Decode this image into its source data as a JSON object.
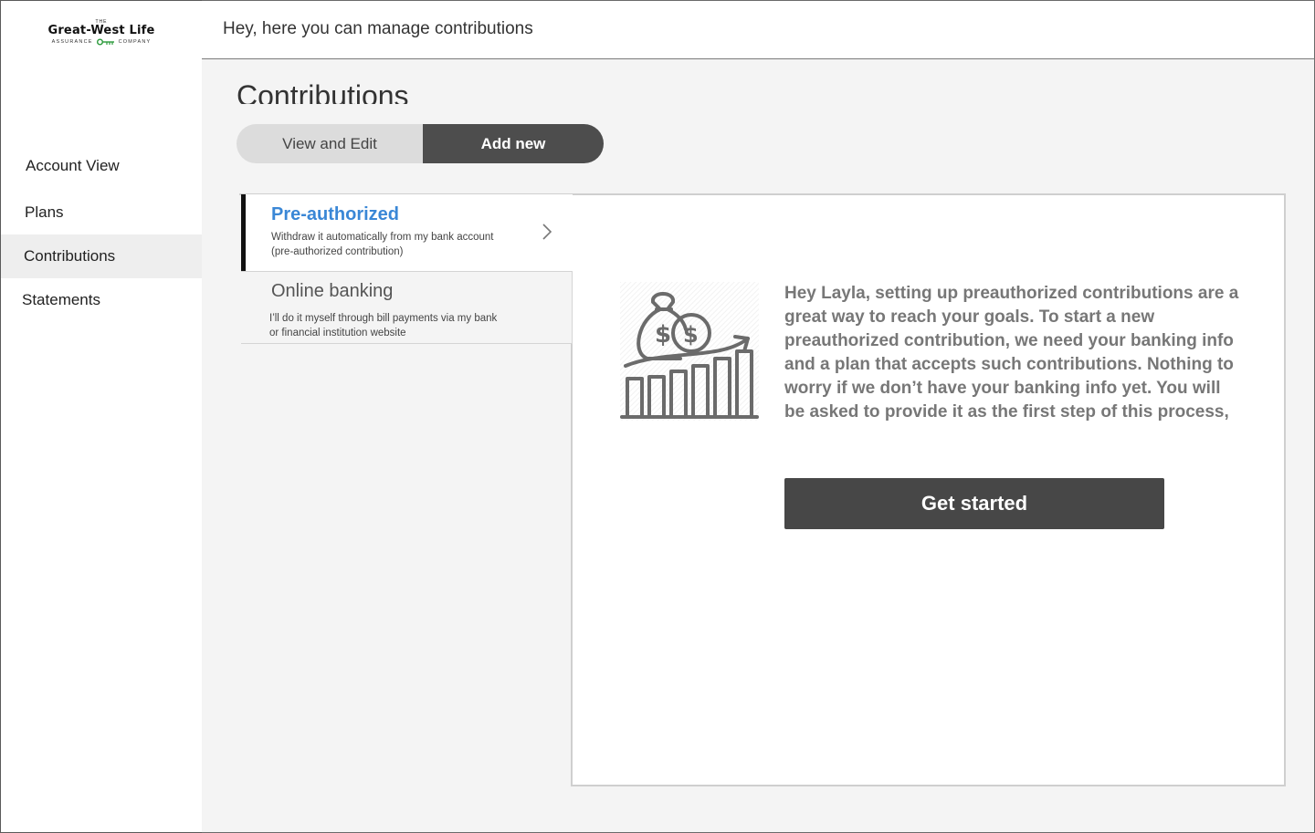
{
  "brand": {
    "the": "THE",
    "name": "Great-West Life",
    "sub_left": "ASSURANCE",
    "sub_right": "COMPANY"
  },
  "sidebar": {
    "items": [
      {
        "label": "Account View"
      },
      {
        "label": "Plans"
      },
      {
        "label": "Contributions",
        "active": true
      },
      {
        "label": "Statements"
      }
    ]
  },
  "header": {
    "greeting": "Hey, here you can manage contributions"
  },
  "main": {
    "title": "Contributions",
    "toggle": {
      "left": "View and Edit",
      "right": "Add new",
      "selected": "Add new"
    },
    "options": [
      {
        "title": "Pre-authorized",
        "desc": "Withdraw it automatically from my bank account (pre-authorized contribution)",
        "active": true
      },
      {
        "title": "Online banking",
        "desc": "I’ll do it myself through bill payments via my bank or financial institution website",
        "active": false
      }
    ],
    "illustration_icon": "money-bag-growth-chart-icon",
    "message": "Hey Layla, setting up preauthorized contributions are a great way to reach your goals. To start a new preauthorized contribution, we need your banking info and a plan that accepts such contributions. Nothing to worry if we don’t have your banking info yet. You will be asked to provide it as the first step of this process,",
    "cta": "Get started"
  },
  "colors": {
    "accent_blue": "#3a87d6",
    "dark_button": "#474747",
    "panel_bg": "#f4f4f4",
    "logo_key_green": "#2a9a3a"
  }
}
